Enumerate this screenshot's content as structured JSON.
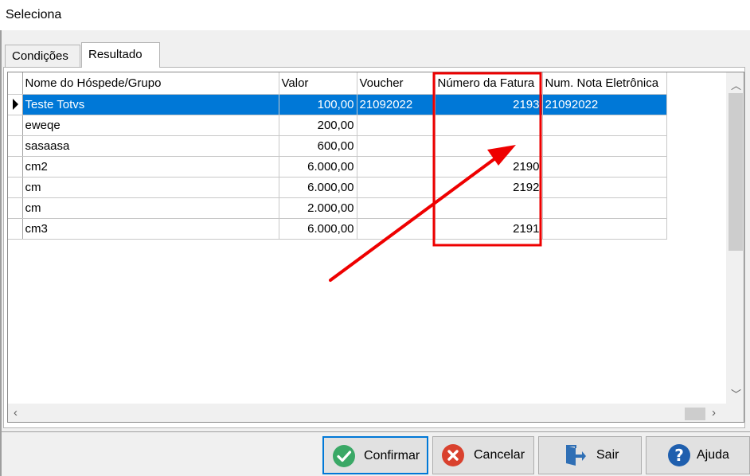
{
  "window": {
    "title": "Seleciona"
  },
  "tabs": [
    {
      "label": "Condições",
      "active": false
    },
    {
      "label": "Resultado",
      "active": true
    }
  ],
  "grid": {
    "columns": [
      "Nome do Hóspede/Grupo",
      "Valor",
      "Voucher",
      "Número da Fatura",
      "Num. Nota Eletrônica"
    ],
    "rows": [
      [
        "Teste Totvs",
        "100,00",
        "21092022",
        "2193",
        "21092022"
      ],
      [
        "eweqe",
        "200,00",
        "",
        "",
        ""
      ],
      [
        "sasaasa",
        "600,00",
        "",
        "",
        ""
      ],
      [
        "cm2",
        "6.000,00",
        "",
        "2190",
        ""
      ],
      [
        "cm",
        "6.000,00",
        "",
        "2192",
        ""
      ],
      [
        "cm",
        "2.000,00",
        "",
        "",
        ""
      ],
      [
        "cm3",
        "6.000,00",
        "",
        "2191",
        ""
      ]
    ],
    "selected_row": 0
  },
  "buttons": {
    "confirm": {
      "label": "Confirmar",
      "color": "#3aa866"
    },
    "cancel": {
      "label": "Cancelar",
      "color": "#d9412e"
    },
    "exit": {
      "label": "Sair",
      "color": "#2f6fb5"
    },
    "help": {
      "label": "Ajuda",
      "color": "#1f5fae"
    }
  },
  "icons": {
    "confirm": "check-circle-icon",
    "cancel": "x-circle-icon",
    "exit": "door-exit-icon",
    "help": "question-circle-icon"
  },
  "annotation": {
    "color": "#ee0000"
  }
}
